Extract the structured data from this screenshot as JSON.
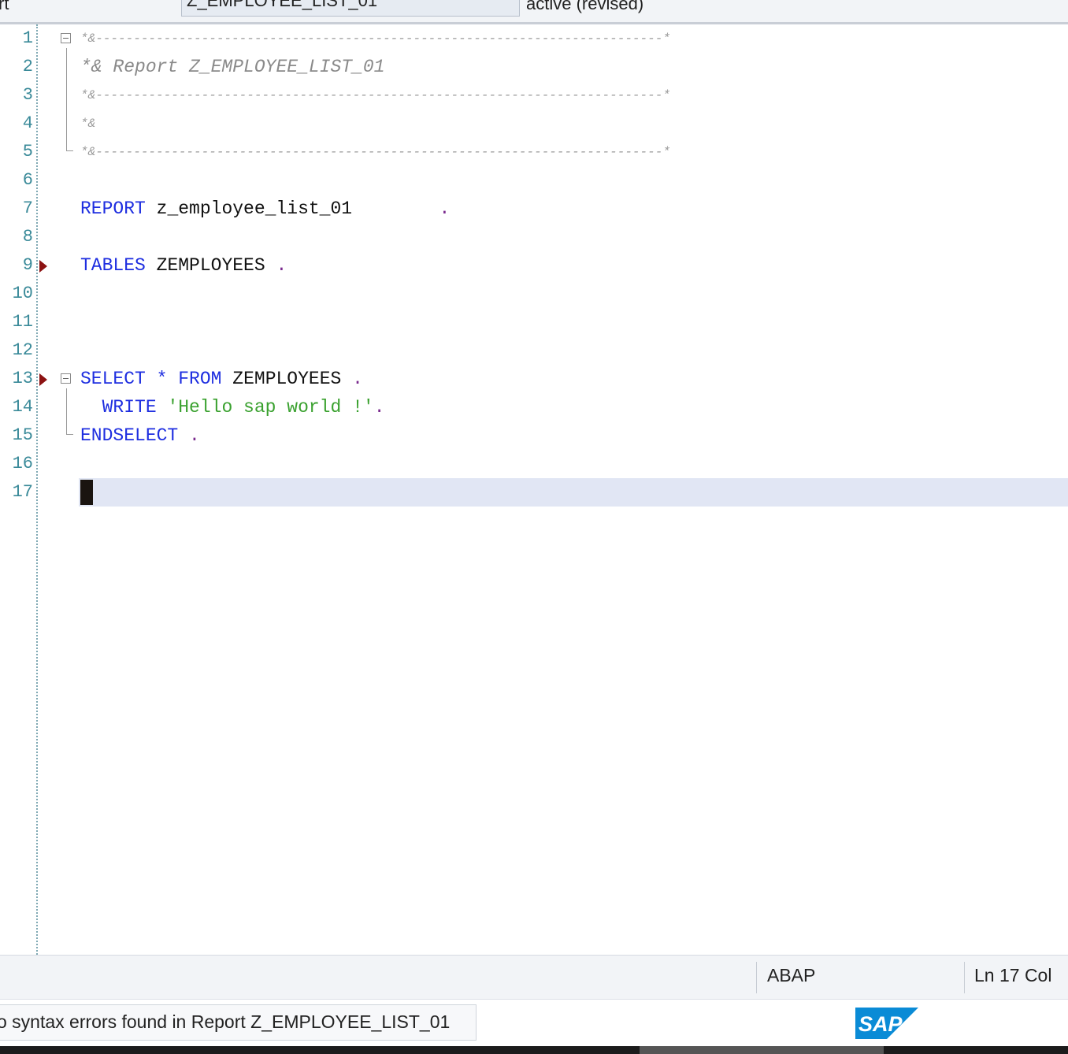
{
  "topbar": {
    "left_label": "rt",
    "program_field": "Z_EMPLOYEE_LIST_01",
    "status": "active (revised)"
  },
  "editor": {
    "lines": [
      {
        "num": "1"
      },
      {
        "num": "2"
      },
      {
        "num": "3"
      },
      {
        "num": "4"
      },
      {
        "num": "5"
      },
      {
        "num": "6"
      },
      {
        "num": "7"
      },
      {
        "num": "8"
      },
      {
        "num": "9"
      },
      {
        "num": "10"
      },
      {
        "num": "11"
      },
      {
        "num": "12"
      },
      {
        "num": "13"
      },
      {
        "num": "14"
      },
      {
        "num": "15"
      },
      {
        "num": "16"
      },
      {
        "num": "17"
      }
    ],
    "comment_rule_start": "*&",
    "comment_rule_dashes": "---------------------------------------------------------------------------*",
    "comment_report": "*& Report Z_EMPLOYEE_LIST_01",
    "comment_blank": "*&",
    "kw_report": "REPORT",
    "report_name": "z_employee_list_01",
    "report_dot": "        .",
    "kw_tables": "TABLES",
    "tables_name": "ZEMPLOYEES",
    "tables_dot": " .",
    "kw_select": "SELECT",
    "select_star": " * ",
    "kw_from": "FROM",
    "select_table": "ZEMPLOYEES",
    "select_dot": " .",
    "kw_write": "WRITE",
    "write_string": "'Hello sap world !'",
    "write_dot": ".",
    "kw_endselect": "ENDSELECT",
    "endselect_dot": " .",
    "current_line": 17
  },
  "statusbar": {
    "language": "ABAP",
    "position": "Ln  17 Col"
  },
  "message": {
    "text": "o syntax errors found in Report Z_EMPLOYEE_LIST_01"
  },
  "brand": {
    "logo_text": "SAP",
    "logo_color": "#0a8bd6"
  }
}
